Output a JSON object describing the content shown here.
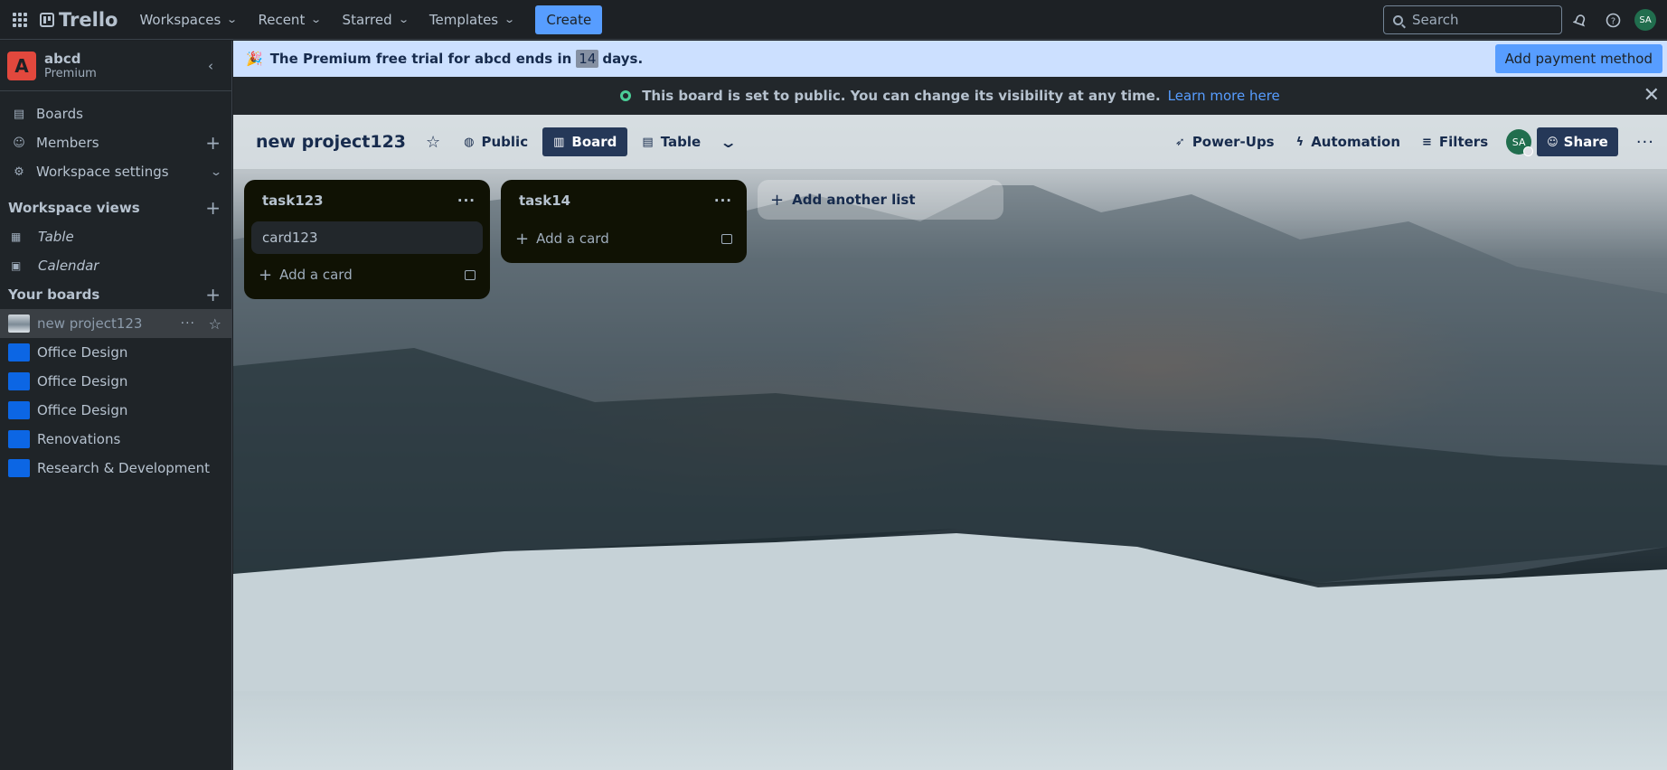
{
  "topnav": {
    "logo": "Trello",
    "menus": [
      "Workspaces",
      "Recent",
      "Starred",
      "Templates"
    ],
    "create": "Create",
    "search_placeholder": "Search",
    "avatar_initials": "SA"
  },
  "sidebar": {
    "workspace_initial": "A",
    "workspace_name": "abcd",
    "workspace_plan": "Premium",
    "items": [
      {
        "label": "Boards",
        "icon": "board-icon"
      },
      {
        "label": "Members",
        "icon": "person-icon"
      },
      {
        "label": "Workspace settings",
        "icon": "gear-icon"
      }
    ],
    "views_heading": "Workspace views",
    "views": [
      {
        "label": "Table",
        "icon": "table-icon"
      },
      {
        "label": "Calendar",
        "icon": "calendar-icon"
      }
    ],
    "boards_heading": "Your boards",
    "boards": [
      {
        "label": "new project123",
        "active": true
      },
      {
        "label": "Office Design"
      },
      {
        "label": "Office Design"
      },
      {
        "label": "Office Design"
      },
      {
        "label": "Renovations"
      },
      {
        "label": "Research & Development"
      }
    ]
  },
  "trial_banner": {
    "emoji": "🎉",
    "prefix": "The Premium free trial for abcd ends in",
    "days": "14",
    "suffix": "days.",
    "button": "Add payment method"
  },
  "public_banner": {
    "text": "This board is set to public. You can change its visibility at any time.",
    "link": "Learn more here"
  },
  "board": {
    "title": "new project123",
    "visibility": "Public",
    "views": [
      "Board",
      "Table"
    ],
    "active_view": "Board",
    "actions": [
      "Power-Ups",
      "Automation",
      "Filters"
    ],
    "member_initials": "SA",
    "share": "Share"
  },
  "lists": [
    {
      "title": "task123",
      "cards": [
        "card123"
      ],
      "add_card": "Add a card"
    },
    {
      "title": "task14",
      "cards": [],
      "add_card": "Add a card"
    }
  ],
  "add_list": "Add another list",
  "colors": {
    "accent": "#579dff",
    "workspace_avatar": "#e2483d",
    "member_avatar": "#216e4e",
    "board_swatch": "#0c66e4"
  }
}
